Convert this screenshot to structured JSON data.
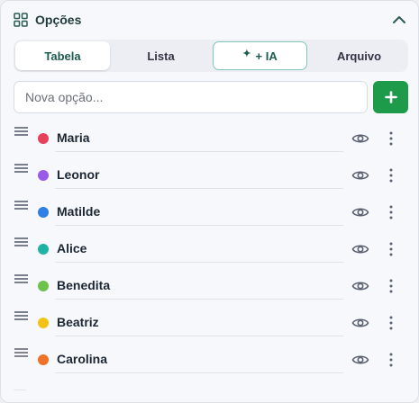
{
  "header": {
    "title": "Opções",
    "icon": "grid-icon",
    "collapse_icon": "chevron-up-icon"
  },
  "tabs": [
    {
      "label": "Tabela",
      "state": "active"
    },
    {
      "label": "Lista",
      "state": "normal"
    },
    {
      "label": "+ IA",
      "state": "highlight",
      "icon": "sparkle-icon"
    },
    {
      "label": "Arquivo",
      "state": "normal"
    }
  ],
  "new_option": {
    "placeholder": "Nova opção...",
    "value": "",
    "add_icon": "plus-icon"
  },
  "options": [
    {
      "name": "Maria",
      "color": "#e8405a"
    },
    {
      "name": "Leonor",
      "color": "#9a5be8"
    },
    {
      "name": "Matilde",
      "color": "#2f7fe6"
    },
    {
      "name": "Alice",
      "color": "#1fb3a6"
    },
    {
      "name": "Benedita",
      "color": "#6cc24a"
    },
    {
      "name": "Beatriz",
      "color": "#f2c315"
    },
    {
      "name": "Carolina",
      "color": "#f07227"
    }
  ],
  "colors": {
    "accent": "#1e9b4a",
    "tab_text_active": "#1d5a4f",
    "ia_border": "#7fc7bd"
  }
}
